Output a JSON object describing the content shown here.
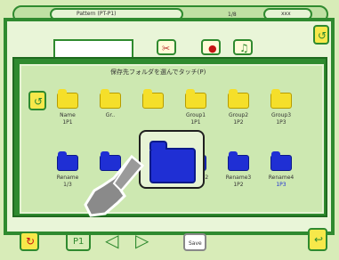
{
  "topbar": {
    "left_text": "Pattern (PT-P1)",
    "right_text": "1/8",
    "right_pill": "xxx"
  },
  "toolbar": {
    "input_value": "",
    "icons": [
      "scissors-icon",
      "red-pin-icon",
      "music-note-icon"
    ]
  },
  "dialog": {
    "title": "保存先フォルダを選んでタッチ(P)"
  },
  "folders": {
    "row1": [
      {
        "color": "yellow",
        "label_top": "Name",
        "label_bottom": "1P1"
      },
      {
        "color": "yellow",
        "label_top": "Gr..",
        "label_bottom": ""
      },
      {
        "color": "yellow",
        "label_top": "",
        "label_bottom": ""
      },
      {
        "color": "yellow",
        "label_top": "Group1",
        "label_bottom": "1P1"
      },
      {
        "color": "yellow",
        "label_top": "Group2",
        "label_bottom": "1P2"
      },
      {
        "color": "yellow",
        "label_top": "Group3",
        "label_bottom": "1P3"
      }
    ],
    "row2": [
      {
        "color": "blue",
        "label_top": "Rename",
        "label_bottom": "1/3"
      },
      {
        "color": "blue",
        "label_top": "",
        "label_bottom": ""
      },
      {
        "color": "blue",
        "label_top": "",
        "label_bottom": ""
      },
      {
        "color": "blue",
        "label_top": "Rename2",
        "label_bottom": "1P1"
      },
      {
        "color": "blue",
        "label_top": "Rename3",
        "label_bottom": "1P2"
      },
      {
        "color": "blue",
        "label_top": "Rename4",
        "label_bottom": "1P3"
      }
    ]
  },
  "bottombar": {
    "home_label": "P1",
    "prev_label": "◁",
    "next_label": "▷",
    "menu_label": "Save"
  }
}
